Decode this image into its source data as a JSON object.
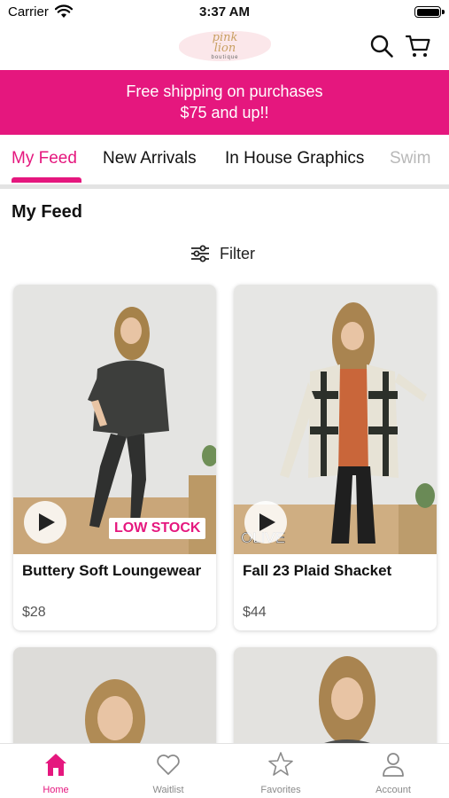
{
  "status_bar": {
    "carrier": "Carrier",
    "time": "3:37 AM"
  },
  "header": {
    "logo": {
      "name_line1": "pink",
      "name_line2": "lion",
      "subtitle": "boutique"
    },
    "search_icon": "search-icon",
    "cart_icon": "cart-icon"
  },
  "promo": {
    "line1": "Free shipping on purchases",
    "line2": "$75 and up!!"
  },
  "tabs": [
    {
      "label": "My Feed",
      "active": true
    },
    {
      "label": "New Arrivals",
      "active": false
    },
    {
      "label": "In House Graphics",
      "active": false
    },
    {
      "label": "Swim",
      "active": false
    }
  ],
  "feed": {
    "title": "My Feed",
    "filter_label": "Filter",
    "products": [
      {
        "name": "Buttery Soft Loungewear",
        "price": "$28",
        "badge": "LOW STOCK",
        "has_video": true
      },
      {
        "name": "Fall 23 Plaid Shacket",
        "price": "$44",
        "badge": "",
        "has_video": true,
        "image_text": "OLIVE"
      }
    ]
  },
  "bottom_nav": [
    {
      "label": "Home",
      "icon": "home-icon",
      "active": true
    },
    {
      "label": "Waitlist",
      "icon": "heart-icon",
      "active": false
    },
    {
      "label": "Favorites",
      "icon": "star-icon",
      "active": false
    },
    {
      "label": "Account",
      "icon": "person-icon",
      "active": false
    }
  ],
  "colors": {
    "accent": "#e5177e",
    "tab_inactive": "#8a8a8a"
  }
}
